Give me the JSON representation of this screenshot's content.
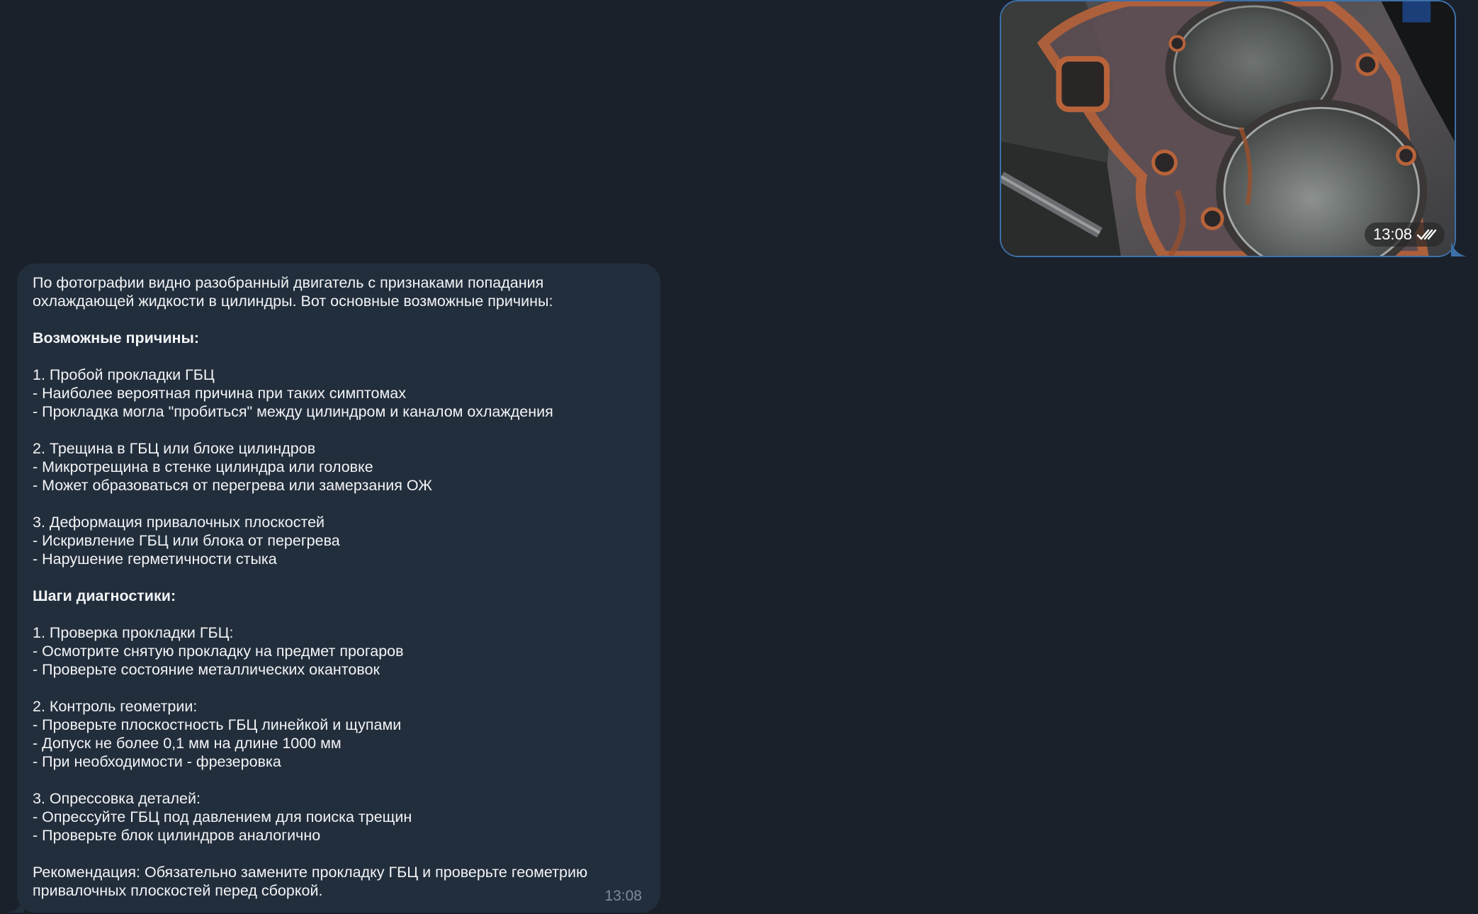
{
  "chat": {
    "outgoing_photo": {
      "time": "13:08",
      "status_icon": "double-check-icon",
      "accent_color": "#3d6fa8"
    },
    "incoming_message": {
      "time": "13:08",
      "lines": [
        {
          "text": "По фотографии видно разобранный двигатель с признаками попадания",
          "bold": false
        },
        {
          "text": "охлаждающей жидкости в цилиндры. Вот основные возможные причины:",
          "bold": false
        },
        {
          "text": "",
          "bold": false
        },
        {
          "text": "Возможные причины:",
          "bold": true
        },
        {
          "text": "",
          "bold": false
        },
        {
          "text": "1. Пробой прокладки ГБЦ",
          "bold": false
        },
        {
          "text": "- Наиболее вероятная причина при таких симптомах",
          "bold": false
        },
        {
          "text": "- Прокладка могла \"пробиться\" между цилиндром и каналом охлаждения",
          "bold": false
        },
        {
          "text": "",
          "bold": false
        },
        {
          "text": "2. Трещина в ГБЦ или блоке цилиндров",
          "bold": false
        },
        {
          "text": "- Микротрещина в стенке цилиндра или головке",
          "bold": false
        },
        {
          "text": "- Может образоваться от перегрева или замерзания ОЖ",
          "bold": false
        },
        {
          "text": "",
          "bold": false
        },
        {
          "text": "3. Деформация привалочных плоскостей",
          "bold": false
        },
        {
          "text": "- Искривление ГБЦ или блока от перегрева",
          "bold": false
        },
        {
          "text": "- Нарушение герметичности стыка",
          "bold": false
        },
        {
          "text": "",
          "bold": false
        },
        {
          "text": "Шаги диагностики:",
          "bold": true
        },
        {
          "text": "",
          "bold": false
        },
        {
          "text": "1. Проверка прокладки ГБЦ:",
          "bold": false
        },
        {
          "text": "- Осмотрите снятую прокладку на предмет прогаров",
          "bold": false
        },
        {
          "text": "- Проверьте состояние металлических окантовок",
          "bold": false
        },
        {
          "text": "",
          "bold": false
        },
        {
          "text": "2. Контроль геометрии:",
          "bold": false
        },
        {
          "text": "- Проверьте плоскостность ГБЦ линейкой и щупами",
          "bold": false
        },
        {
          "text": "- Допуск не более 0,1 мм на длине 1000 мм",
          "bold": false
        },
        {
          "text": "- При необходимости - фрезеровка",
          "bold": false
        },
        {
          "text": "",
          "bold": false
        },
        {
          "text": "3. Опрессовка деталей:",
          "bold": false
        },
        {
          "text": "- Опрессуйте ГБЦ под давлением для поиска трещин",
          "bold": false
        },
        {
          "text": "- Проверьте блок цилиндров аналогично",
          "bold": false
        },
        {
          "text": "",
          "bold": false
        },
        {
          "text": "Рекомендация: Обязательно замените прокладку ГБЦ и проверьте геометрию",
          "bold": false
        },
        {
          "text": "привалочных плоскостей перед сборкой.",
          "bold": false
        }
      ]
    }
  },
  "colors": {
    "background": "#1a212b",
    "incoming_bubble": "#232e3c",
    "text": "#f2f4f6",
    "time_text": "#7d8b99"
  }
}
